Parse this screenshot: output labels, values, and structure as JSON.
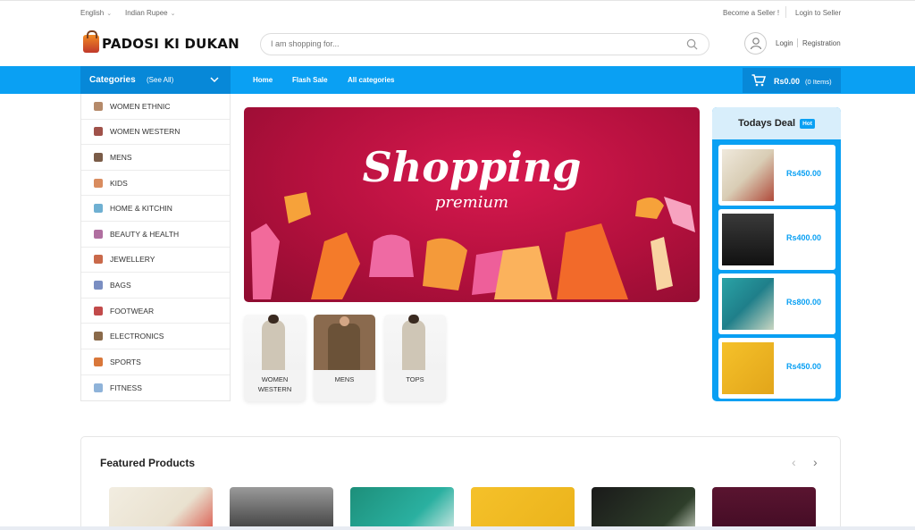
{
  "topbar": {
    "language": "English",
    "currency": "Indian Rupee",
    "become_seller": "Become a Seller !",
    "login_seller": "Login to Seller"
  },
  "header": {
    "logo_text": "PADOSI KI DUKAN",
    "search_placeholder": "I am shopping for...",
    "login": "Login",
    "registration": "Registration"
  },
  "nav": {
    "categories_title": "Categories",
    "see_all": "(See All)",
    "links": [
      "Home",
      "Flash Sale",
      "All categories"
    ],
    "cart_amount": "Rs0.00",
    "cart_items": "(0 Items)"
  },
  "sidebar": {
    "items": [
      {
        "label": "WOMEN ETHNIC",
        "icon": "saree-icon",
        "color": "#b58a6a"
      },
      {
        "label": "WOMEN WESTERN",
        "icon": "dress-icon",
        "color": "#a0524a"
      },
      {
        "label": "MENS",
        "icon": "man-icon",
        "color": "#7a5c48"
      },
      {
        "label": "KIDS",
        "icon": "kid-icon",
        "color": "#d98c5f"
      },
      {
        "label": "HOME & KITCHIN",
        "icon": "home-icon",
        "color": "#6fb0d2"
      },
      {
        "label": "BEAUTY & HEALTH",
        "icon": "beauty-icon",
        "color": "#b06fa0"
      },
      {
        "label": "JEWELLERY",
        "icon": "jewel-icon",
        "color": "#c9694a"
      },
      {
        "label": "BAGS",
        "icon": "bag-icon",
        "color": "#7a8ec2"
      },
      {
        "label": "FOOTWEAR",
        "icon": "shoe-icon",
        "color": "#c24a4a"
      },
      {
        "label": "ELECTRONICS",
        "icon": "electronics-icon",
        "color": "#8a6a4a"
      },
      {
        "label": "SPORTS",
        "icon": "sports-icon",
        "color": "#d9773a"
      },
      {
        "label": "FITNESS",
        "icon": "fitness-icon",
        "color": "#8fb3d9"
      }
    ]
  },
  "banner": {
    "title": "Shopping",
    "subtitle": "premium"
  },
  "category_cards": [
    {
      "label": "WOMEN WESTERN"
    },
    {
      "label": "MENS"
    },
    {
      "label": "TOPS"
    }
  ],
  "deal": {
    "title": "Todays Deal",
    "badge": "Hot",
    "items": [
      {
        "price": "Rs450.00"
      },
      {
        "price": "Rs400.00"
      },
      {
        "price": "Rs800.00"
      },
      {
        "price": "Rs450.00"
      }
    ]
  },
  "featured": {
    "title": "Featured Products",
    "prev": "‹",
    "next": "›"
  },
  "colors": {
    "brand_blue": "#0aa0f3",
    "dark_blue": "#0788d8",
    "banner_red": "#b3103d"
  }
}
